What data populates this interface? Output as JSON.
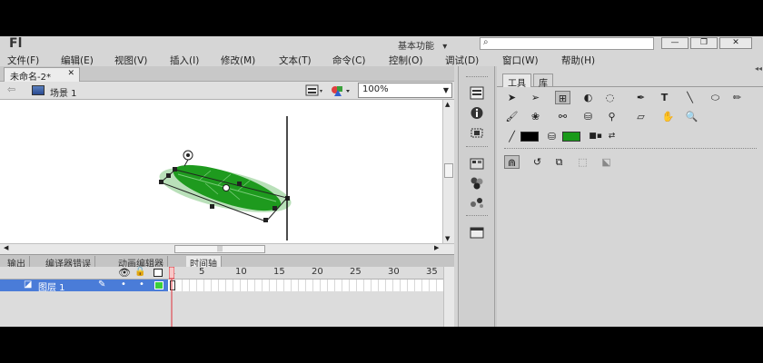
{
  "app": {
    "logo": "Fl",
    "workspace": "基本功能",
    "workspace_arrow": "▾",
    "search_placeholder": "",
    "window_buttons": [
      "—",
      "❐",
      "✕"
    ]
  },
  "menu": [
    "文件(F)",
    "编辑(E)",
    "视图(V)",
    "插入(I)",
    "修改(M)",
    "文本(T)",
    "命令(C)",
    "控制(O)",
    "调试(D)",
    "窗口(W)",
    "帮助(H)"
  ],
  "document": {
    "tab_label": "未命名-2*",
    "tab_close": "✕",
    "scene_label": "场景 1",
    "zoom": "100%"
  },
  "bottom_tabs": [
    "输出",
    "编译器错误",
    "动画编辑器",
    "时间轴"
  ],
  "timeline": {
    "layer_name": "图层 1",
    "frame_numbers": [
      "1",
      "5",
      "10",
      "15",
      "20",
      "25",
      "30",
      "35"
    ],
    "current_frame": 1
  },
  "tools": {
    "tabs": [
      "工具",
      "库"
    ],
    "rows": [
      [
        "selection-icon",
        "subselection-icon",
        "free-transform-icon",
        "3d-rotation-icon",
        "lasso-icon",
        "pen-icon",
        "text-icon",
        "line-icon",
        "oval-icon",
        "pencil-icon"
      ],
      [
        "brush-icon",
        "deco-icon",
        "bone-icon",
        "paint-bucket-icon",
        "eyedropper-icon",
        "eraser-icon",
        "hand-icon",
        "zoom-icon"
      ]
    ],
    "stroke_color": "#000000",
    "fill_color": "#1a9a1a"
  },
  "colors": {
    "leaf_fill": "#1e9a1e",
    "leaf_glow": "#b9e0b9",
    "layer_highlight": "#4a7cd8",
    "playhead": "#e0303a"
  }
}
